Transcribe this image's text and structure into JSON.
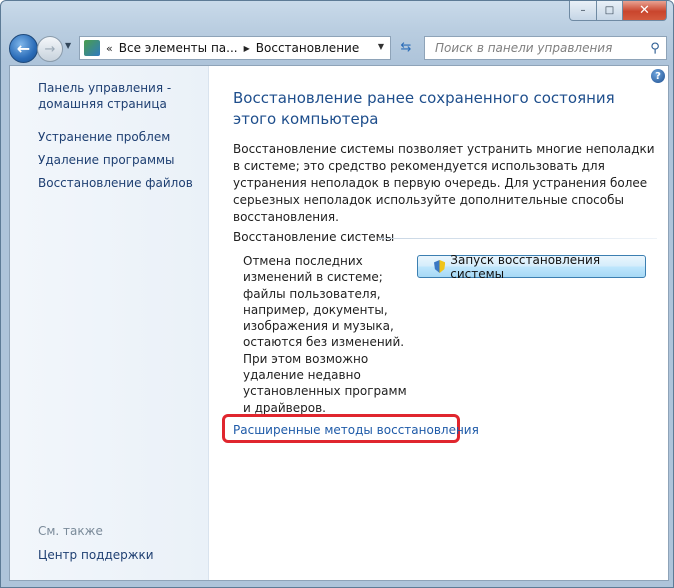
{
  "window": {
    "caption": {
      "minimize": "–",
      "maximize": "□",
      "close": "✕"
    }
  },
  "nav": {
    "back_icon": "arrow-left",
    "forward_icon": "arrow-right",
    "address": {
      "chevron": "«",
      "crumbs": [
        "Все элементы па...",
        "Восстановление"
      ],
      "separator": "▶"
    },
    "search_placeholder": "Поиск в панели управления"
  },
  "sidebar": {
    "home_line1": "Панель управления -",
    "home_line2": "домашняя страница",
    "items": [
      "Устранение проблем",
      "Удаление программы",
      "Восстановление файлов"
    ],
    "see_also": "См. также",
    "support_center": "Центр поддержки"
  },
  "main": {
    "help_icon": "?",
    "heading": "Восстановление ранее сохраненного состояния этого компьютера",
    "description": "Восстановление системы позволяет устранить многие неполадки в системе; это средство рекомендуется использовать для устранения неполадок в первую очередь. Для устранения более серьезных неполадок используйте дополнительные способы восстановления.",
    "section_title": "Восстановление системы",
    "section_description": "Отмена последних изменений в системе; файлы пользователя, например, документы, изображения и музыка, остаются без изменений. При этом возможно удаление недавно установленных программ и драйверов.",
    "restore_button": "Запуск восстановления системы",
    "advanced_link": "Расширенные методы восстановления"
  },
  "colors": {
    "link": "#1e5aa8",
    "heading": "#1e4e8c",
    "highlight": "#e0262e"
  }
}
